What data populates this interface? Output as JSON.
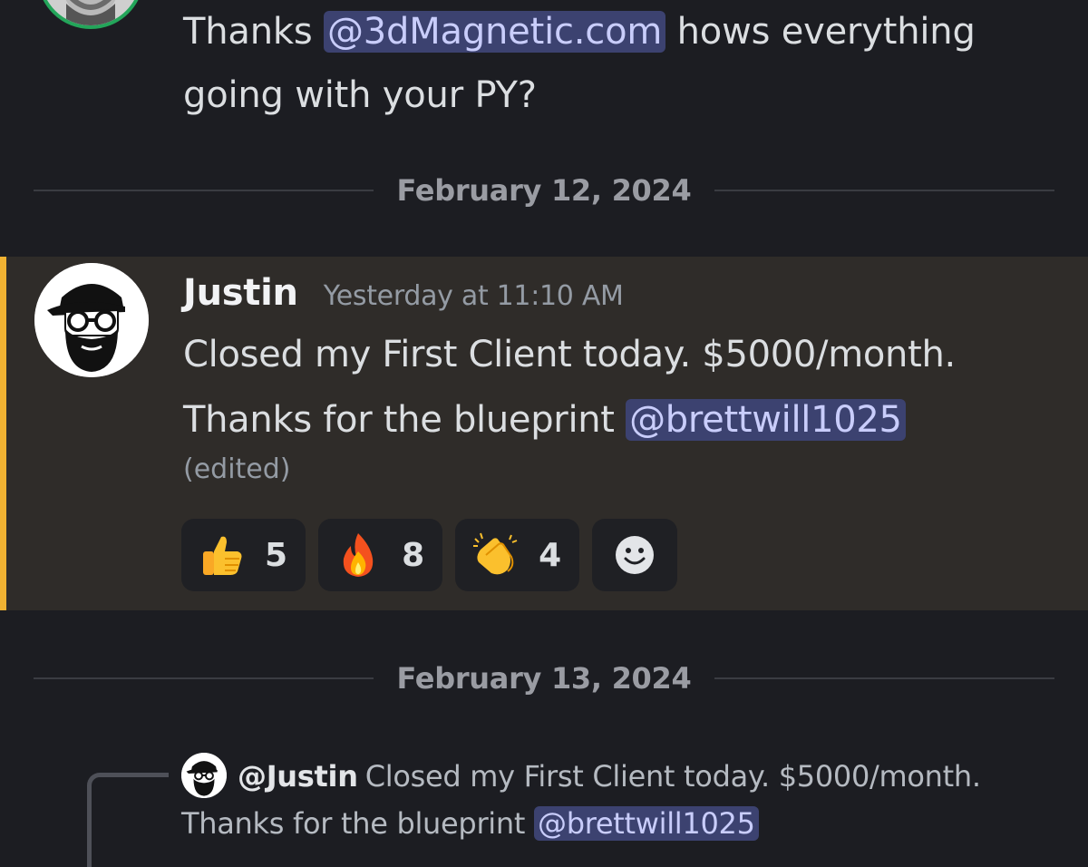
{
  "previous_message": {
    "text_before": "Thanks ",
    "mention": "@3dMagnetic.com",
    "text_after": "  hows everything going with your PY?"
  },
  "dividers": {
    "first": "February 12, 2024",
    "second": "February 13, 2024"
  },
  "message": {
    "username": "Justin",
    "timestamp": "Yesterday at 11:10 AM",
    "line1": "Closed my First Client today. $5000/month.",
    "line2": "Thanks for the blueprint ",
    "mention": "@brettwill1025",
    "edited": "(edited)",
    "reactions": [
      {
        "emoji": "thumbs-up",
        "count": "5"
      },
      {
        "emoji": "fire",
        "count": "8"
      },
      {
        "emoji": "clapping-hands",
        "count": "4"
      }
    ]
  },
  "reply": {
    "username": "@Justin",
    "text": "Closed my First Client today. $5000/month. Thanks for the blueprint ",
    "mention": "@brettwill1025"
  },
  "colors": {
    "background": "#1c1d22",
    "highlight": "#2f2c29",
    "highlight_bar": "#f0b232",
    "mention_bg": "#3c4270",
    "online_ring": "#23a55a"
  }
}
